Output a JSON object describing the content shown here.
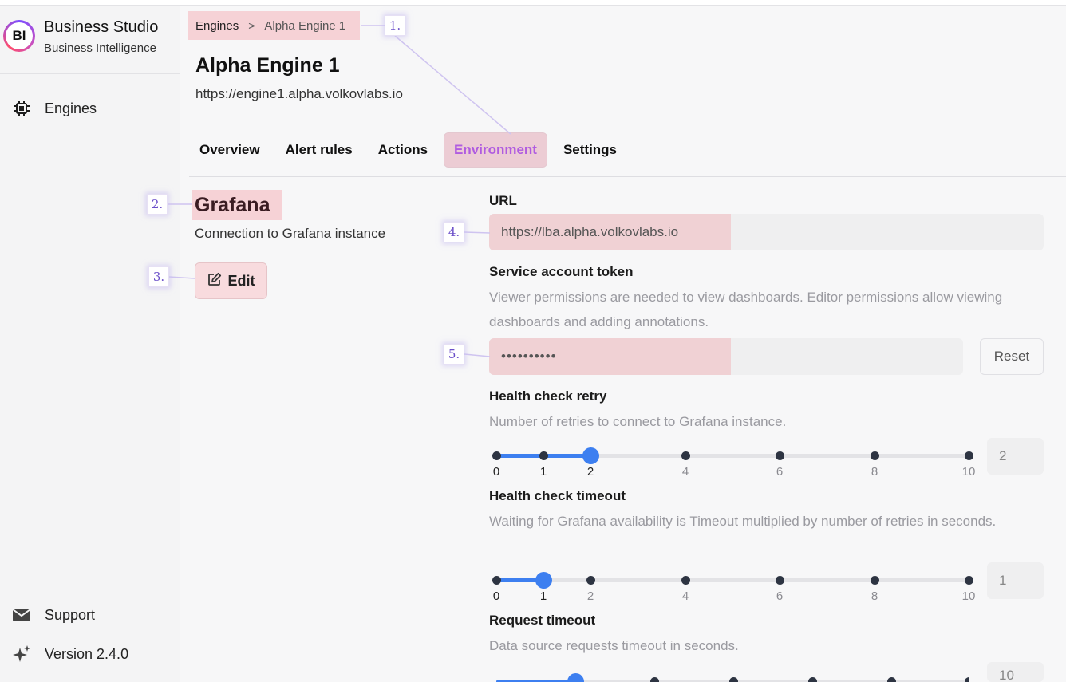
{
  "brand": {
    "logo_text": "BI",
    "title": "Business Studio",
    "subtitle": "Business Intelligence"
  },
  "sidebar": {
    "items": [
      {
        "label": "Engines",
        "icon": "chip-icon"
      }
    ],
    "footer": [
      {
        "label": "Support",
        "icon": "mail-icon"
      },
      {
        "label": "Version 2.4.0",
        "icon": "sparkle-icon"
      }
    ]
  },
  "breadcrumb": {
    "items": [
      "Engines",
      "Alpha Engine 1"
    ],
    "separator": ">"
  },
  "page": {
    "title": "Alpha Engine 1",
    "url": "https://engine1.alpha.volkovlabs.io"
  },
  "tabs": [
    {
      "label": "Overview",
      "active": false
    },
    {
      "label": "Alert rules",
      "active": false
    },
    {
      "label": "Actions",
      "active": false
    },
    {
      "label": "Environment",
      "active": true
    },
    {
      "label": "Settings",
      "active": false
    }
  ],
  "section": {
    "title": "Grafana",
    "description": "Connection to Grafana instance",
    "edit_label": "Edit"
  },
  "fields": {
    "url": {
      "label": "URL",
      "value": "https://lba.alpha.volkovlabs.io"
    },
    "token": {
      "label": "Service account token",
      "help": "Viewer permissions are needed to view dashboards. Editor permissions allow viewing dashboards and adding annotations.",
      "value": "••••••••••",
      "reset_label": "Reset"
    },
    "retry": {
      "label": "Health check retry",
      "help": "Number of retries to connect to Grafana instance.",
      "value": "2",
      "slider_value": 2,
      "ticks": [
        "0",
        "1",
        "2",
        "4",
        "6",
        "8",
        "10"
      ]
    },
    "timeout": {
      "label": "Health check timeout",
      "help": "Waiting for Grafana availability is Timeout multiplied by number of retries in seconds.",
      "value": "1",
      "slider_value": 1,
      "ticks": [
        "0",
        "1",
        "2",
        "4",
        "6",
        "8",
        "10"
      ]
    },
    "request": {
      "label": "Request timeout",
      "help": "Data source requests timeout in seconds.",
      "value": "10"
    }
  },
  "annotations": [
    "1.",
    "2.",
    "3.",
    "4.",
    "5."
  ],
  "colors": {
    "accent": "#3d7ff0",
    "active_tab": "#b05ce0",
    "highlight": "#f5b4b9"
  }
}
